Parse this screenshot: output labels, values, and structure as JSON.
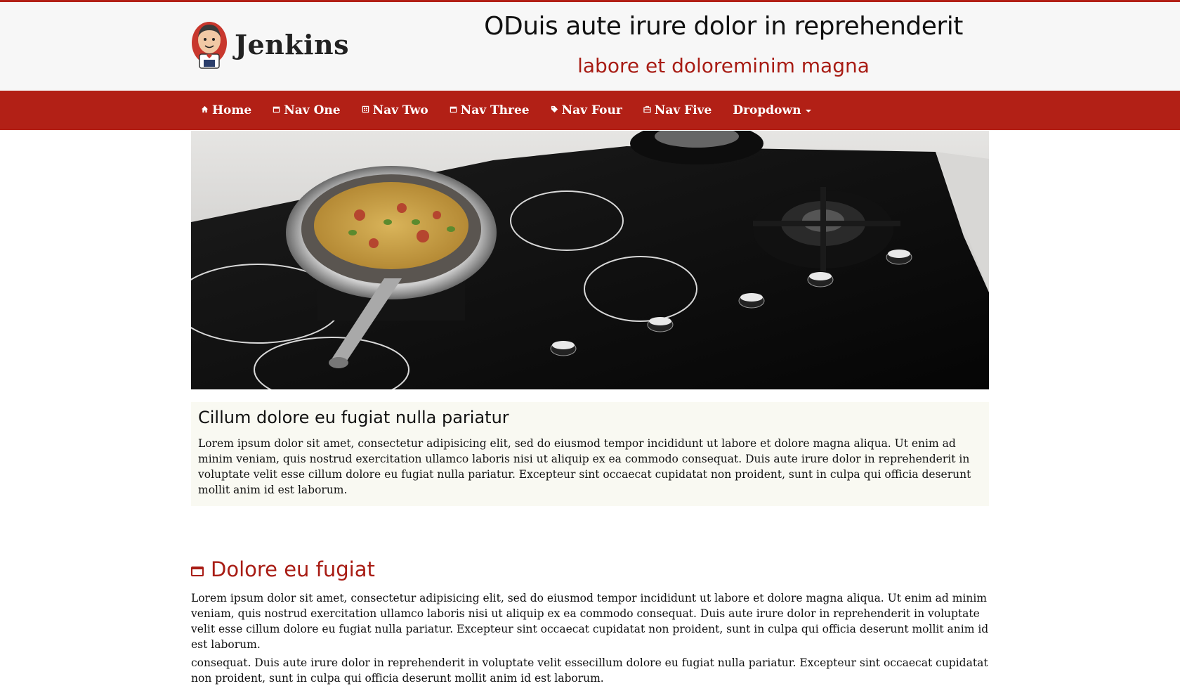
{
  "header": {
    "logo_text": "Jenkins",
    "title": "ODuis aute irure dolor in reprehenderit",
    "subtitle": "labore et doloreminim magna"
  },
  "nav": {
    "items": [
      {
        "label": "Home",
        "icon": "home-icon"
      },
      {
        "label": "Nav One",
        "icon": "calendar-icon"
      },
      {
        "label": "Nav Two",
        "icon": "grid-icon"
      },
      {
        "label": "Nav Three",
        "icon": "calendar-icon"
      },
      {
        "label": "Nav Four",
        "icon": "tag-icon"
      },
      {
        "label": "Nav Five",
        "icon": "briefcase-icon"
      },
      {
        "label": "Dropdown",
        "icon": "chevron-down-icon"
      }
    ]
  },
  "hero": {
    "image": "cooktop-with-frying-pan"
  },
  "well": {
    "heading": "Cillum dolore eu fugiat nulla pariatur",
    "text": "Lorem ipsum dolor sit amet, consectetur adipisicing elit, sed do eiusmod tempor incididunt ut labore et dolore magna aliqua. Ut enim ad minim veniam, quis nostrud exercitation ullamco laboris nisi ut aliquip ex ea commodo consequat. Duis aute irure dolor in reprehenderit in voluptate velit esse cillum dolore eu fugiat nulla pariatur. Excepteur sint occaecat cupidatat non proident, sunt in culpa qui officia deserunt mollit anim id est laborum."
  },
  "section": {
    "heading": "Dolore eu fugiat",
    "icon": "window-icon",
    "paragraph1": "Lorem ipsum dolor sit amet, consectetur adipisicing elit, sed do eiusmod tempor incididunt ut labore et dolore magna aliqua. Ut enim ad minim veniam, quis nostrud exercitation ullamco laboris nisi ut aliquip ex ea commodo consequat. Duis aute irure dolor in reprehenderit in voluptate velit esse cillum dolore eu fugiat nulla pariatur. Excepteur sint occaecat cupidatat non proident, sunt in culpa qui officia deserunt mollit anim id est laborum.",
    "paragraph2": "consequat. Duis aute irure dolor in reprehenderit in voluptate velit essecillum dolore eu fugiat nulla pariatur. Excepteur sint occaecat cupidatat non proident, sunt in culpa qui officia deserunt mollit anim id est laborum."
  },
  "colors": {
    "brand_red": "#b22016",
    "accent_red": "#a81c14",
    "header_bg": "#f7f7f7",
    "well_bg": "#f9f9f2"
  }
}
